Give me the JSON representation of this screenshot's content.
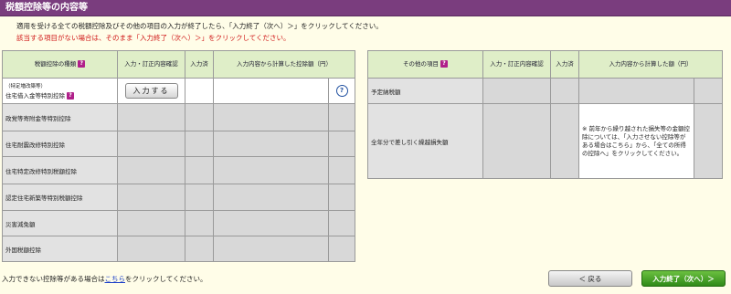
{
  "title": "税額控除等の内容等",
  "instructions": {
    "line1": "適用を受ける全ての税額控除及びその他の項目の入力が終了したら、「入力終了（次へ）＞」をクリックしてください。",
    "line2": "該当する項目がない場合は、そのまま「入力終了（次へ）＞」をクリックしてください。"
  },
  "left_table": {
    "headers": {
      "type": "税額控除の種類",
      "confirm": "入力・訂正内容確認",
      "done": "入力済",
      "amount": "入力内容から計算した控除額（円）"
    },
    "rows": [
      {
        "prefix": "（特定増改築等）",
        "name": "住宅借入金等特別控除",
        "button": "入力する",
        "help": "?"
      },
      {
        "name": "政党等寄附金等特別控除"
      },
      {
        "name": "住宅耐震改修特別控除"
      },
      {
        "name": "住宅特定改修特別税額控除"
      },
      {
        "name": "認定住宅新築等特別税額控除"
      },
      {
        "name": "災害減免額"
      },
      {
        "name": "外国税額控除"
      }
    ]
  },
  "right_table": {
    "headers": {
      "item": "その他の項目",
      "confirm": "入力・訂正内容確認",
      "done": "入力済",
      "amount": "入力内容から計算した額（円）"
    },
    "rows": [
      {
        "name": "予定納税額"
      },
      {
        "name": "全年分で差し引く繰越損失額",
        "note": "※ 前年から繰り越された損失等の金額控除については、「入力させない控除等がある場合はこちら」から、「全ての所得の控除へ」をクリックしてください。"
      }
    ]
  },
  "bottom": {
    "text_before": "入力できない控除等がある場合は",
    "link": "こちら",
    "text_after": "をクリックしてください。"
  },
  "buttons": {
    "back": "＜ 戻る",
    "next": "入力終了（次へ）＞"
  },
  "colors": {
    "title_bar": "#7a3d7e",
    "header_bg": "#dfeec8",
    "page_bg": "#fffde8",
    "next_button": "#3a9a20"
  }
}
